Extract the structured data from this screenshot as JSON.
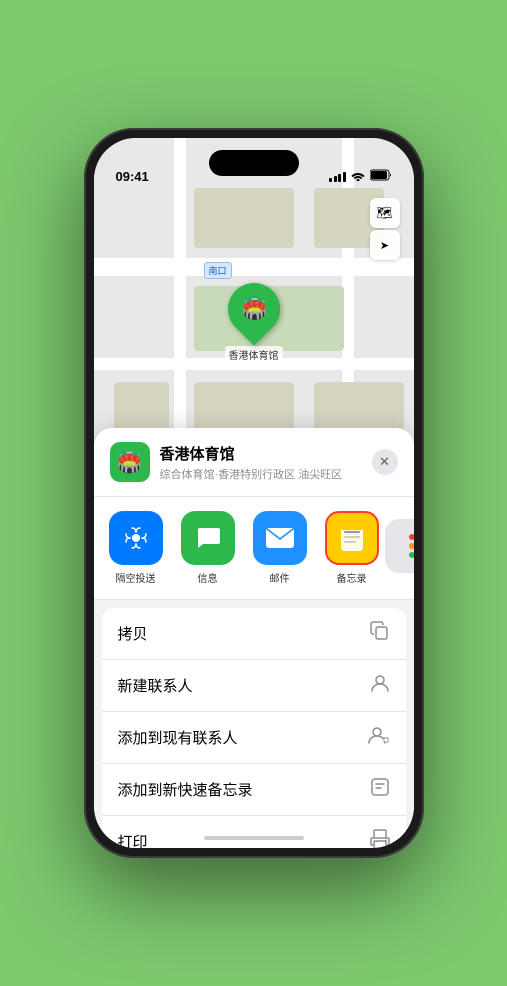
{
  "status_bar": {
    "time": "09:41",
    "signal_label": "signal",
    "wifi_label": "wifi",
    "battery_label": "battery"
  },
  "map": {
    "label_text": "南口",
    "pin_label": "香港体育馆",
    "map_icon": "🏟️"
  },
  "map_controls": {
    "layers_icon": "🗺",
    "location_icon": "➤"
  },
  "location_header": {
    "icon": "🏟️",
    "name": "香港体育馆",
    "subtitle": "综合体育馆·香港特别行政区 油尖旺区",
    "close_label": "✕"
  },
  "share_items": [
    {
      "id": "airdrop",
      "icon": "📡",
      "bg": "#007aff",
      "label": "隔空投送",
      "highlighted": false
    },
    {
      "id": "messages",
      "icon": "💬",
      "bg": "#2db84b",
      "label": "信息",
      "highlighted": false
    },
    {
      "id": "mail",
      "icon": "✉️",
      "bg": "#1e90ff",
      "label": "邮件",
      "highlighted": false
    },
    {
      "id": "notes",
      "icon": "📝",
      "bg": "#ffcc00",
      "label": "备忘录",
      "highlighted": true
    }
  ],
  "share_more": {
    "icon": "⋯",
    "dots": [
      "#ff3b30",
      "#ff9500",
      "#2db84b"
    ]
  },
  "action_items": [
    {
      "id": "copy",
      "label": "拷贝",
      "icon": "⎘"
    },
    {
      "id": "new-contact",
      "label": "新建联系人",
      "icon": "👤"
    },
    {
      "id": "add-existing",
      "label": "添加到现有联系人",
      "icon": "👤+"
    },
    {
      "id": "add-note",
      "label": "添加到新快速备忘录",
      "icon": "📋"
    },
    {
      "id": "print",
      "label": "打印",
      "icon": "🖨"
    }
  ]
}
